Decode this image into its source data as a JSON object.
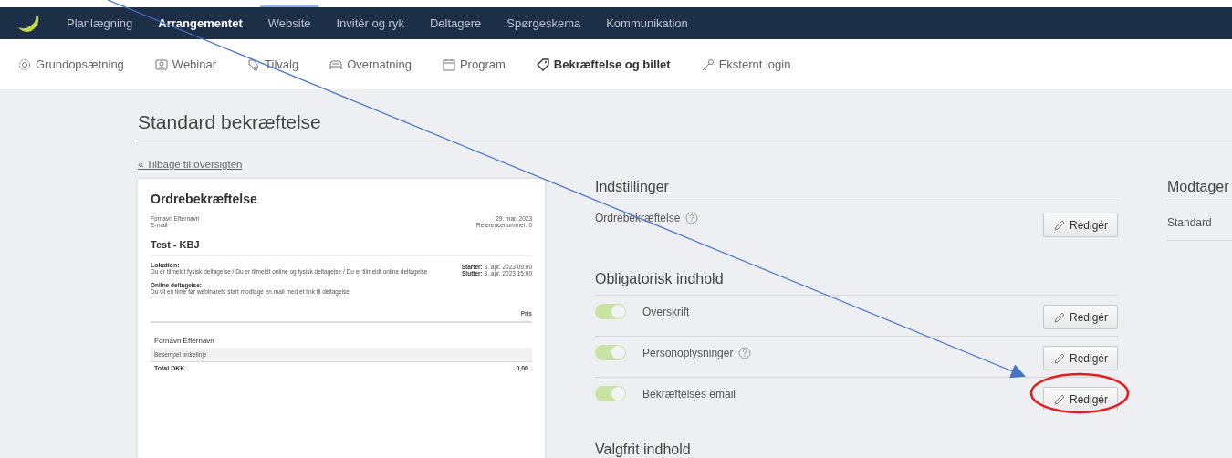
{
  "top_nav": {
    "items": [
      {
        "label": "Planlægning",
        "selected": false,
        "hovered": false
      },
      {
        "label": "Arrangementet",
        "selected": true,
        "hovered": false
      },
      {
        "label": "Website",
        "selected": false,
        "hovered": true
      },
      {
        "label": "Invitér og ryk",
        "selected": false,
        "hovered": false
      },
      {
        "label": "Deltagere",
        "selected": false,
        "hovered": false
      },
      {
        "label": "Spørgeskema",
        "selected": false,
        "hovered": false
      },
      {
        "label": "Kommunikation",
        "selected": false,
        "hovered": false
      }
    ]
  },
  "sub_nav": {
    "items": [
      {
        "label": "Grundopsætning",
        "kind": "gear",
        "selected": false
      },
      {
        "label": "Webinar",
        "kind": "person",
        "selected": false
      },
      {
        "label": "Tilvalg",
        "kind": "tags",
        "selected": false
      },
      {
        "label": "Overnatning",
        "kind": "bed",
        "selected": false
      },
      {
        "label": "Program",
        "kind": "calendar",
        "selected": false
      },
      {
        "label": "Bekræftelse og billet",
        "kind": "ticket",
        "selected": true
      },
      {
        "label": "Eksternt login",
        "kind": "key",
        "selected": false
      }
    ]
  },
  "page": {
    "title": "Standard bekræftelse",
    "back_link": "« Tilbage til oversigten"
  },
  "preview": {
    "title": "Ordrebekræftelse",
    "customer_name": "Fornavn Efternavn",
    "email": "E-mail",
    "date": "29. mar. 2023",
    "reference": "Referencenummer: 0",
    "event_title": "Test - KBJ",
    "location_label": "Lokation:",
    "location_text": "Du er tilmeldt fysisk deltagelse / Du er tilmeldt online og fysisk deltagelse / Du er tilmeldt online deltagelse",
    "starts_label": "Starter:",
    "starts_value": "3. apr. 2023 09:00",
    "ends_label": "Slutter:",
    "ends_value": "3. apr. 2023 15:00",
    "online_label": "Online deltagelse:",
    "online_text": "Du vil en time før webinarets start modtage en mail med et link til deltagelse.",
    "price_header": "Pris",
    "attendee": "Fornavn Efternavn",
    "order_line": "Besempel ordrelinje",
    "total_label": "Total DKK",
    "total_value": "0,00"
  },
  "settings": {
    "title": "Indstillinger",
    "rows": [
      {
        "label": "Ordrebekræftelse",
        "help": true,
        "button": "Redigér"
      }
    ]
  },
  "mandatory": {
    "title": "Obligatorisk indhold",
    "rows": [
      {
        "label": "Overskrift",
        "on": true,
        "help": false,
        "button": "Redigér"
      },
      {
        "label": "Personoplysninger",
        "on": true,
        "help": true,
        "button": "Redigér"
      },
      {
        "label": "Bekræftelses email",
        "on": true,
        "help": false,
        "button": "Redigér"
      }
    ]
  },
  "optional": {
    "title": "Valgfrit indhold"
  },
  "recipients": {
    "title": "Modtager",
    "rows": [
      "Standard"
    ]
  }
}
